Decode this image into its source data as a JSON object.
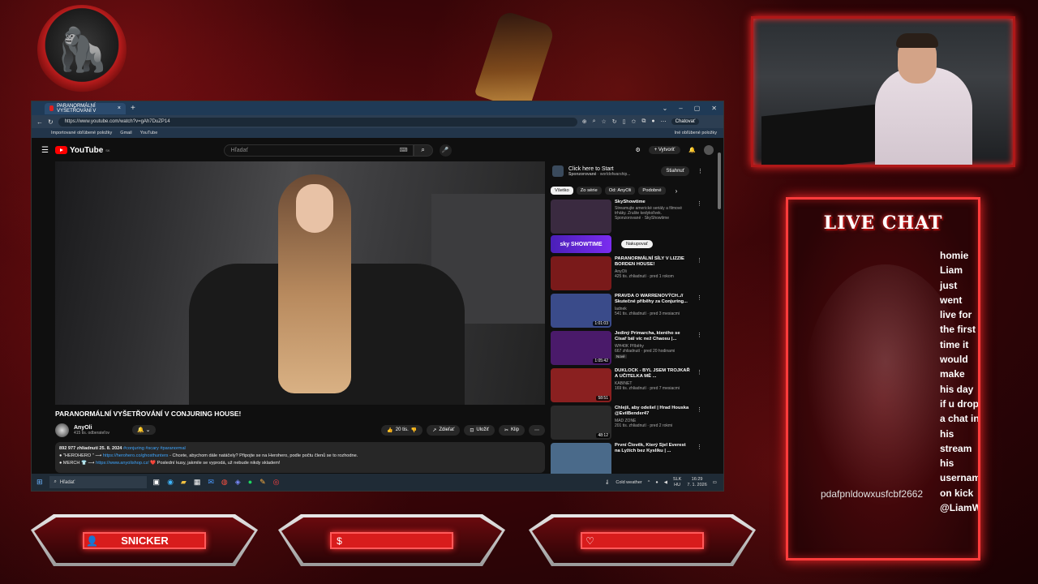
{
  "browser": {
    "tab_title": "PARANORMÁLNÍ VYŠETŘOVÁNÍ V",
    "tab_close": "×",
    "new_tab": "+",
    "win_controls": [
      "⌄",
      "–",
      "▢",
      "✕"
    ],
    "url": "https://www.youtube.com/watch?v=gAh7DuZP14",
    "chat_button": "Chatovať",
    "bookmarks": [
      "Importované obľúbené položky",
      "Gmail",
      "YouTube"
    ],
    "bookmarks_right": "Iné obľúbené položky"
  },
  "youtube": {
    "logo": "YouTube",
    "logo_region": "SK",
    "search_placeholder": "Hľadať",
    "create_label": "Vytvoriť",
    "video_title": "PARANORMÁLNÍ VYŠETŘOVÁNÍ V CONJURING HOUSE!",
    "channel_name": "AnyOli",
    "channel_subs": "415 tis. odberateľov",
    "likes": "20 tis.",
    "share": "Zdieľať",
    "save": "Uložiť",
    "clip": "Klip",
    "desc_meta": "892 977 zhliadnutí  25. 8. 2024",
    "desc_tags": "#conjuring #scary #paranormal",
    "desc_line1_prefix": "● \"HEROHERO \" ⟶",
    "desc_line1_link": "https://herohero.co/ghosthunters",
    "desc_line1_text": " - Chcete, abychom dále natáčely? Připojte se na Herohero, podle počtu členů se to rozhodne.",
    "desc_line2_prefix": "● MERCH 👕 ⟶",
    "desc_line2_link": "https://www.anyolishop.cz/",
    "desc_line2_text": " ❤️  Poslední kusy, jakmile se vyprodá, už nebude nikdy skladem!",
    "ad": {
      "title": "Click here to Start",
      "sponsored": "Sponzorované",
      "source": "worldofwarship...",
      "button": "Stiahnuť"
    },
    "chips": [
      "Všetko",
      "Zo série",
      "Od: AnyOli",
      "Podobné"
    ],
    "recs": [
      {
        "title": "SkyShowtime",
        "ch": "Streamujte americké seriály a filmové trháky. Zrušte kedykoľvek.",
        "meta": "Sponzorované · SkyShowtime",
        "dur": "",
        "badge": "",
        "color": "#3a2a40"
      },
      {
        "title": "PARANORMÁLNÍ SÍLY V LIZZIE BORDEN HOUSE!",
        "ch": "AnyOli",
        "meta": "425 tis. zhliadnutí · pred 1 rokom",
        "dur": "",
        "badge": "",
        "color": "#7a1a1a"
      },
      {
        "title": "PRAVDA O WARRENOVÝCH..// Skutečné příběhy za Conjuring...",
        "ch": "ladnek",
        "meta": "541 tis. zhliadnutí · pred 3 mesiacmi",
        "dur": "1:01:03",
        "badge": "",
        "color": "#3a4b8a"
      },
      {
        "title": "Jediný Primarcha, kterého se Císař bál víc než Chaosu |...",
        "ch": "WH40K Příběhy",
        "meta": "667 zhliadnutí · pred 20 hodinami",
        "dur": "1:05:42",
        "badge": "Nové",
        "color": "#4a1a6a"
      },
      {
        "title": "DUKLOCK - BYL JSEM TROJKAŘ A UČITELKA MĚ ...",
        "ch": "KABINET",
        "meta": "169 tis. zhliadnutí · pred 7 mesiacmi",
        "dur": "58:51",
        "badge": "",
        "color": "#8a2020"
      },
      {
        "title": "Chlejš, aby odešel | Hrad Houska @EvilBender47",
        "ch": "MAD ZONE",
        "meta": "201 tis. zhliadnutí · pred 2 rokmi",
        "dur": "48:12",
        "badge": "",
        "color": "#2a2a2a"
      },
      {
        "title": "První Člověk, Který Sjel Everest na Lyžích bez Kyslíku | ...",
        "ch": "",
        "meta": "",
        "dur": "",
        "badge": "",
        "color": "#4a6a8a"
      }
    ],
    "sky_banner": "sky SHOWTIME",
    "buy": "Nakupovať"
  },
  "taskbar": {
    "search": "Hľadať",
    "weather": "Cold weather",
    "lang": "SLK",
    "lang2": "HU",
    "time": "16:29",
    "date": "7. 1. 2026"
  },
  "overlay": {
    "live_chat_title": "LIVE CHAT",
    "chat_message": "homie Liam just went live for the first time it would make his day if u drop a chat in his stream his usernam on kick @LiamW",
    "chat_user": "pdafpnldowxusfcbf2662",
    "panels": [
      {
        "icon": "👤",
        "label": "SNICKER"
      },
      {
        "icon": "$",
        "label": ""
      },
      {
        "icon": "♡",
        "label": ""
      }
    ]
  }
}
